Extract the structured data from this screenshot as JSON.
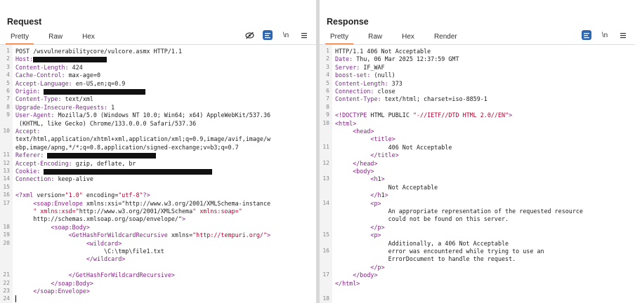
{
  "request": {
    "title": "Request",
    "tabs": [
      "Pretty",
      "Raw",
      "Hex"
    ],
    "wrap_label": "\\n",
    "lines": [
      {
        "n": "1",
        "t": "POST /wsvulnerabilitycore/vulcore.asmx HTTP/1.1"
      },
      {
        "n": "2",
        "k": "Host:",
        "v": "",
        "r": 105
      },
      {
        "n": "3",
        "k": "Content-Length:",
        "v": " 424"
      },
      {
        "n": "4",
        "k": "Cache-Control:",
        "v": " max-age=0"
      },
      {
        "n": "5",
        "k": "Accept-Language:",
        "v": " en-US,en;q=0.9"
      },
      {
        "n": "6",
        "k": "Origin:",
        "v": " ",
        "r": 145
      },
      {
        "n": "7",
        "k": "Content-Type:",
        "v": " text/xml"
      },
      {
        "n": "8",
        "k": "Upgrade-Insecure-Requests:",
        "v": " 1"
      },
      {
        "n": "9",
        "k": "User-Agent:",
        "v": " Mozilla/5.0 (Windows NT 10.0; Win64; x64) AppleWebKit/537.36"
      },
      {
        "n": "",
        "t": " (KHTML, like Gecko) Chrome/133.0.0.0 Safari/537.36"
      },
      {
        "n": "10",
        "k": "Accept:",
        "v": ""
      },
      {
        "n": "",
        "t": "text/html,application/xhtml+xml,application/xml;q=0.9,image/avif,image/w"
      },
      {
        "n": "",
        "t": "ebp,image/apng,*/*;q=0.8,application/signed-exchange;v=b3;q=0.7"
      },
      {
        "n": "11",
        "k": "Referer:",
        "v": " ",
        "r": 155
      },
      {
        "n": "12",
        "k": "Accept-Encoding:",
        "v": " gzip, deflate, br"
      },
      {
        "n": "13",
        "k": "Cookie:",
        "v": " ",
        "r": 240
      },
      {
        "n": "14",
        "k": "Connection:",
        "v": " keep-alive"
      },
      {
        "n": "15",
        "t": ""
      },
      {
        "n": "16",
        "x": "<?xml version=\"1.0\" encoding=\"utf-8\"?>"
      },
      {
        "n": "17",
        "x": "     <soap:Envelope xmlns:xsi=\"http://www.w3.org/2001/XMLSchema-instance"
      },
      {
        "n": "",
        "x": "     \" xmlns:xsd=\"http://www.w3.org/2001/XMLSchema\" xmlns:soap=\""
      },
      {
        "n": "",
        "x": "     http://schemas.xmlsoap.org/soap/envelope/\">"
      },
      {
        "n": "18",
        "x": "          <soap:Body>"
      },
      {
        "n": "19",
        "x": "               <GetHashForWildcardRecursive xmlns=\"http://tempuri.org/\">"
      },
      {
        "n": "20",
        "x": "                    <wildcard>"
      },
      {
        "n": "",
        "t": "                         \\C:\\tmp\\file1.txt"
      },
      {
        "n": "",
        "x": "                    </wildcard>"
      },
      {
        "n": "",
        "t": ""
      },
      {
        "n": "21",
        "x": "               </GetHashForWildcardRecursive>"
      },
      {
        "n": "22",
        "x": "          </soap:Body>"
      },
      {
        "n": "23",
        "x": "     </soap:Envelope>"
      },
      {
        "n": "24",
        "t": ""
      }
    ]
  },
  "response": {
    "title": "Response",
    "tabs": [
      "Pretty",
      "Raw",
      "Hex",
      "Render"
    ],
    "wrap_label": "\\n",
    "lines": [
      {
        "n": "1",
        "t": "HTTP/1.1 406 Not Acceptable"
      },
      {
        "n": "2",
        "k": "Date:",
        "v": " Thu, 06 Mar 2025 12:37:59 GMT"
      },
      {
        "n": "3",
        "k": "Server:",
        "v": " IF_WAF"
      },
      {
        "n": "4",
        "k": "boost-set:",
        "v": " (null)"
      },
      {
        "n": "5",
        "k": "Content-Length:",
        "v": " 373"
      },
      {
        "n": "6",
        "k": "Connection:",
        "v": " close"
      },
      {
        "n": "7",
        "k": "Content-Type:",
        "v": " text/html; charset=iso-8859-1"
      },
      {
        "n": "8",
        "t": ""
      },
      {
        "n": "9",
        "x": "<!DOCTYPE HTML PUBLIC \"-//IETF//DTD HTML 2.0//EN\">"
      },
      {
        "n": "10",
        "x": "<html>"
      },
      {
        "n": "",
        "x": "     <head>"
      },
      {
        "n": "",
        "x": "          <title>"
      },
      {
        "n": "11",
        "t": "               406 Not Acceptable"
      },
      {
        "n": "",
        "x": "          </title>"
      },
      {
        "n": "12",
        "x": "     </head>"
      },
      {
        "n": "",
        "x": "     <body>"
      },
      {
        "n": "13",
        "x": "          <h1>"
      },
      {
        "n": "",
        "t": "               Not Acceptable"
      },
      {
        "n": "",
        "x": "          </h1>"
      },
      {
        "n": "14",
        "x": "          <p>"
      },
      {
        "n": "",
        "t": "               An appropriate representation of the requested resource"
      },
      {
        "n": "",
        "t": "               could not be found on this server."
      },
      {
        "n": "",
        "x": "          </p>"
      },
      {
        "n": "15",
        "x": "          <p>"
      },
      {
        "n": "",
        "t": "               Additionally, a 406 Not Acceptable"
      },
      {
        "n": "16",
        "t": "               error was encountered while trying to use an"
      },
      {
        "n": "",
        "t": "               ErrorDocument to handle the request."
      },
      {
        "n": "",
        "x": "          </p>"
      },
      {
        "n": "17",
        "x": "     </body>"
      },
      {
        "n": "",
        "x": "</html>"
      },
      {
        "n": "",
        "t": ""
      },
      {
        "n": "18",
        "t": ""
      }
    ]
  },
  "colors": {
    "accent_tab": "#e8622a",
    "blue_button": "#2f66b3",
    "key": "#7a2b8c",
    "string": "#b8002f"
  }
}
